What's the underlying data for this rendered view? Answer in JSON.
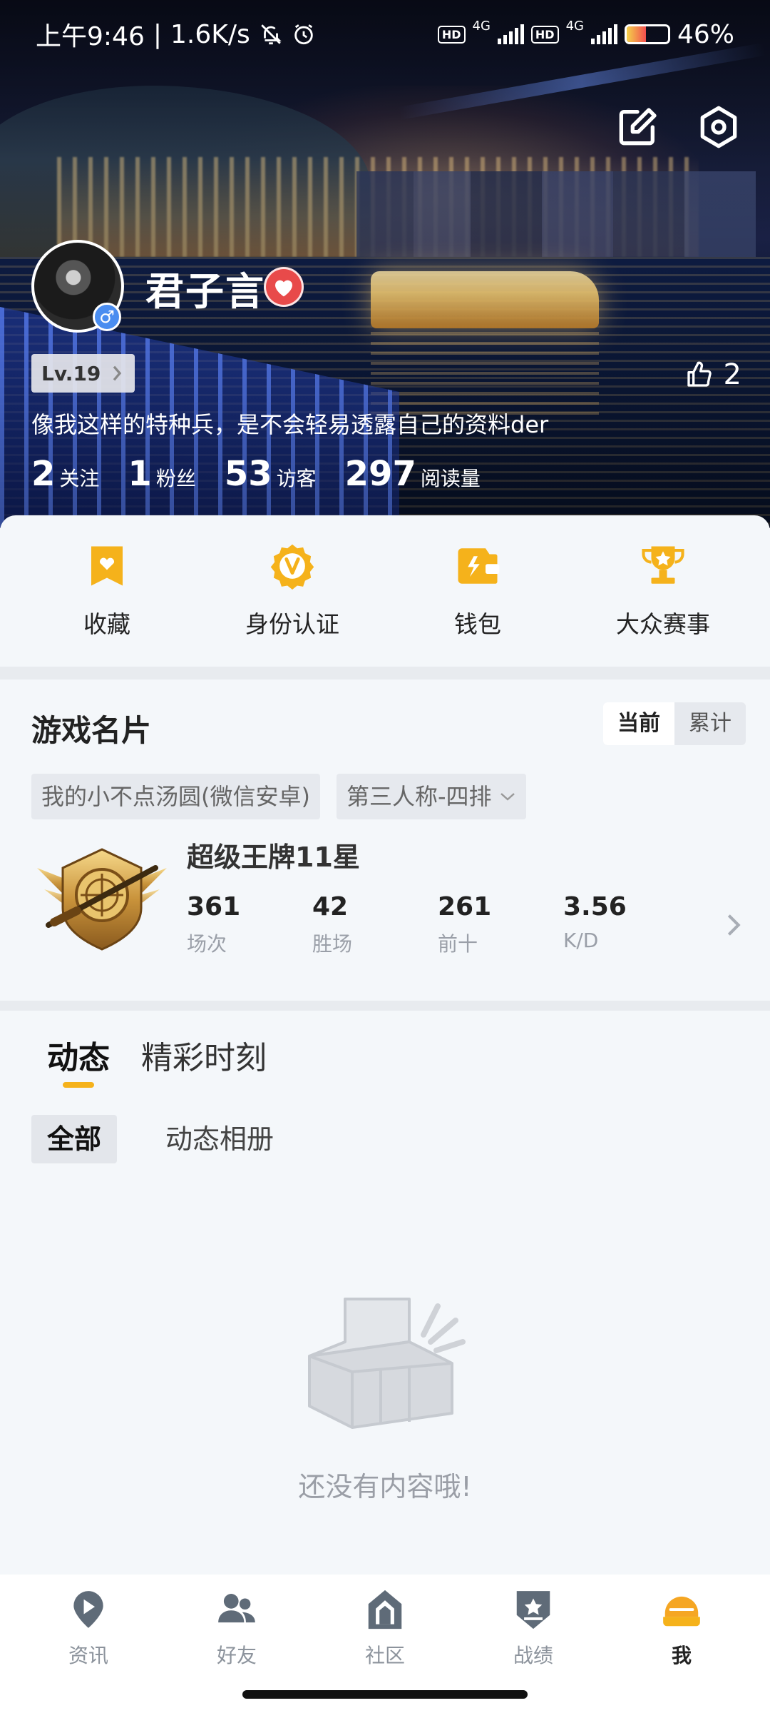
{
  "status_bar": {
    "time": "上午9:46",
    "speed": "1.6K/s",
    "hd": "HD",
    "net": "4G",
    "battery": "46%",
    "battery_level": 0.46
  },
  "header": {
    "edit_icon": "edit-icon",
    "settings_icon": "hex-settings-icon"
  },
  "profile": {
    "nickname": "君子言",
    "gender_symbol": "♂",
    "level": "Lv.19",
    "likes": "2",
    "bio": "像我这样的特种兵，是不会轻易透露自己的资料der",
    "stats": [
      {
        "num": "2",
        "label": "关注"
      },
      {
        "num": "1",
        "label": "粉丝"
      },
      {
        "num": "53",
        "label": "访客"
      },
      {
        "num": "297",
        "label": "阅读量"
      }
    ]
  },
  "shortcuts": [
    {
      "label": "收藏",
      "icon": "bookmark-icon"
    },
    {
      "label": "身份认证",
      "icon": "verify-v-icon"
    },
    {
      "label": "钱包",
      "icon": "wallet-icon"
    },
    {
      "label": "大众赛事",
      "icon": "trophy-icon"
    }
  ],
  "game_card": {
    "title": "游戏名片",
    "toggle": {
      "current": "当前",
      "cumulative": "累计",
      "selected": "当前"
    },
    "account": "我的小不点汤圆(微信安卓)",
    "mode": "第三人称-四排",
    "rank": "超级王牌11星",
    "stats": [
      {
        "value": "361",
        "label": "场次"
      },
      {
        "value": "42",
        "label": "胜场"
      },
      {
        "value": "261",
        "label": "前十"
      },
      {
        "value": "3.56",
        "label": "K/D"
      }
    ]
  },
  "feed": {
    "tabs": [
      "动态",
      "精彩时刻"
    ],
    "active_tab": "动态",
    "subtabs": [
      "全部",
      "动态相册"
    ],
    "active_subtab": "全部",
    "empty_text": "还没有内容哦!"
  },
  "bottom_nav": [
    {
      "label": "资讯",
      "icon": "news-play-icon"
    },
    {
      "label": "好友",
      "icon": "friends-icon"
    },
    {
      "label": "社区",
      "icon": "community-house-icon"
    },
    {
      "label": "战绩",
      "icon": "record-shield-icon"
    },
    {
      "label": "我",
      "icon": "helmet-icon",
      "active": true
    }
  ],
  "colors": {
    "accent": "#f5b21b",
    "icon_gray": "#5f6b78",
    "heart_badge": "#e84a4a",
    "gender_blue": "#4a8df0"
  }
}
